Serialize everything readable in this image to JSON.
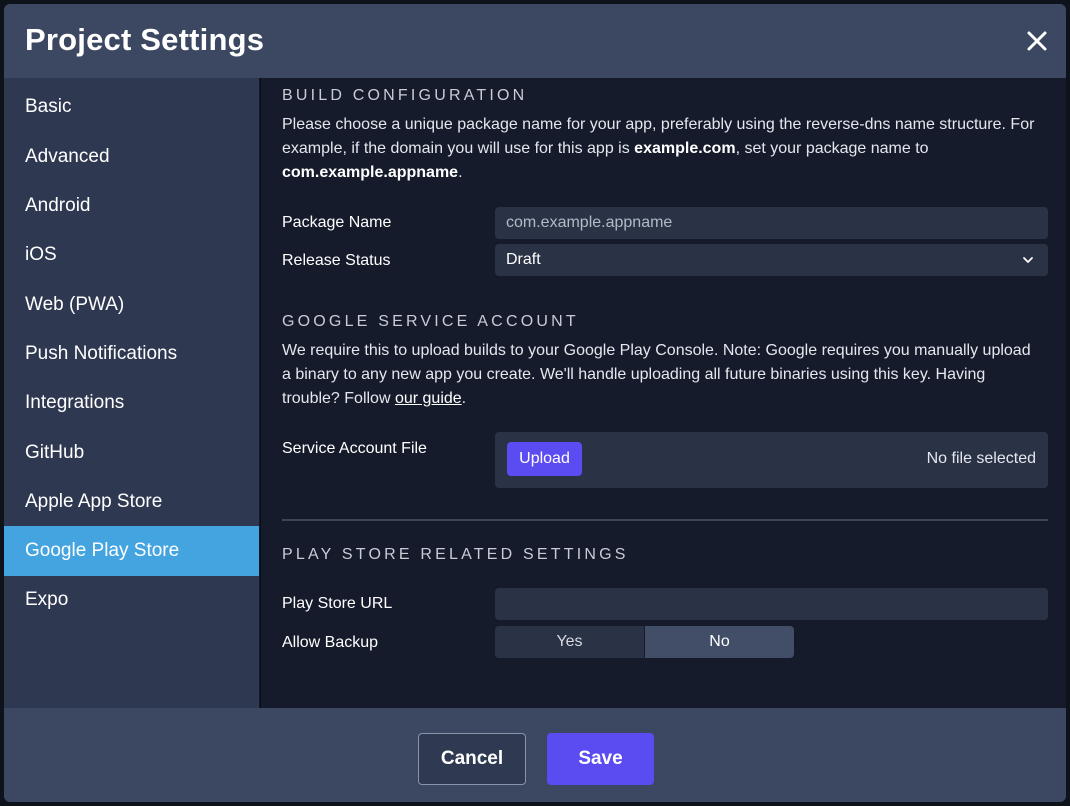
{
  "dialog": {
    "title": "Project Settings",
    "close_icon": "close-icon"
  },
  "sidebar": {
    "items": [
      {
        "label": "Basic"
      },
      {
        "label": "Advanced"
      },
      {
        "label": "Android"
      },
      {
        "label": "iOS"
      },
      {
        "label": "Web (PWA)"
      },
      {
        "label": "Push Notifications"
      },
      {
        "label": "Integrations"
      },
      {
        "label": "GitHub"
      },
      {
        "label": "Apple App Store"
      },
      {
        "label": "Google Play Store",
        "active": true
      },
      {
        "label": "Expo"
      }
    ]
  },
  "build": {
    "heading": "BUILD CONFIGURATION",
    "desc_1": "Please choose a unique package name for your app, preferably using the reverse-dns name structure. For example, if the domain you will use for this app is ",
    "desc_domain": "example.com",
    "desc_2": ", set your package name to ",
    "desc_package": "com.example.appname",
    "desc_3": ".",
    "package_label": "Package Name",
    "package_placeholder": "com.example.appname",
    "release_label": "Release Status",
    "release_value": "Draft"
  },
  "service": {
    "heading": "GOOGLE SERVICE ACCOUNT",
    "desc_1": "We require this to upload builds to your Google Play Console. Note: Google requires you manually upload a binary to any new app you create. We'll handle uploading all future binaries using this key. Having trouble? Follow ",
    "desc_link": "our guide",
    "desc_2": ".",
    "file_label": "Service Account File",
    "upload_label": "Upload",
    "file_status": "No file selected"
  },
  "play_store": {
    "heading": "PLAY STORE RELATED SETTINGS",
    "url_label": "Play Store URL",
    "url_value": "",
    "backup_label": "Allow Backup",
    "backup_yes": "Yes",
    "backup_no": "No",
    "backup_selected": "No"
  },
  "footer": {
    "cancel_label": "Cancel",
    "save_label": "Save"
  },
  "colors": {
    "accent": "#5b4cf2",
    "active_nav": "#44a4e0",
    "header_bg": "#3c4862"
  }
}
